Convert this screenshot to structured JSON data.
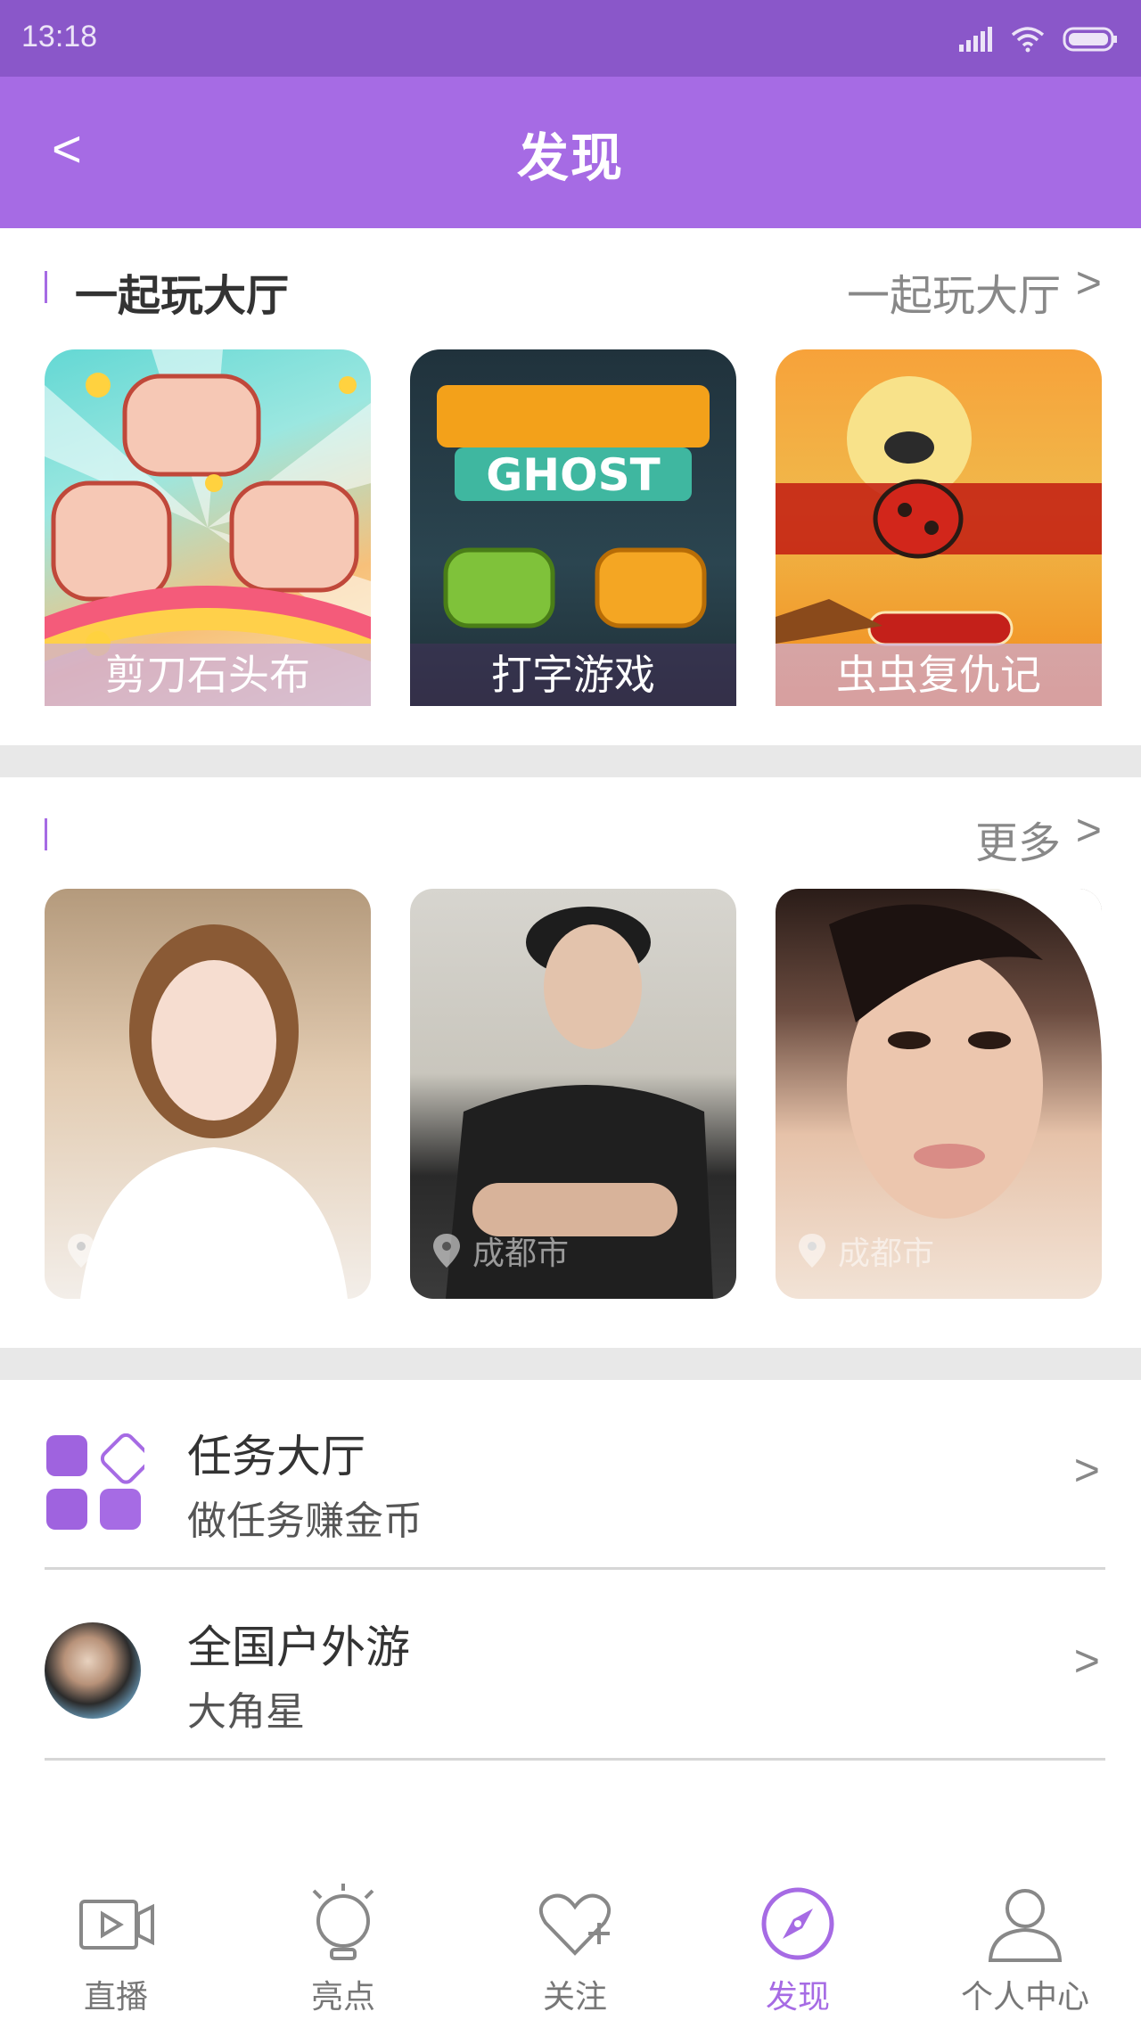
{
  "status_bar": {
    "time": "13:18"
  },
  "header": {
    "back": "<",
    "title": "发现"
  },
  "games_section": {
    "title": "一起玩大厅",
    "more": "一起玩大厅",
    "arrow": ">",
    "items": [
      {
        "label": "剪刀石头布"
      },
      {
        "label": "打字游戏"
      },
      {
        "label": "虫虫复仇记"
      }
    ]
  },
  "people_section": {
    "title": "",
    "more": "更多",
    "arrow": ">",
    "items": [
      {
        "location": "成都市"
      },
      {
        "location": "成都市"
      },
      {
        "location": "成都市"
      }
    ]
  },
  "list": [
    {
      "title": "任务大厅",
      "subtitle": "做任务赚金币",
      "arrow": ">"
    },
    {
      "title": "全国户外游",
      "subtitle": "大角星",
      "arrow": ">"
    }
  ],
  "tabbar": {
    "tabs": [
      {
        "label": "直播",
        "icon": "live-video-icon"
      },
      {
        "label": "亮点",
        "icon": "lightbulb-icon"
      },
      {
        "label": "关注",
        "icon": "heart-plus-icon"
      },
      {
        "label": "发现",
        "icon": "compass-icon"
      },
      {
        "label": "个人中心",
        "icon": "person-icon"
      }
    ],
    "active": 3
  },
  "colors": {
    "accent": "#a66be4",
    "status_bar": "#8a57c9"
  }
}
